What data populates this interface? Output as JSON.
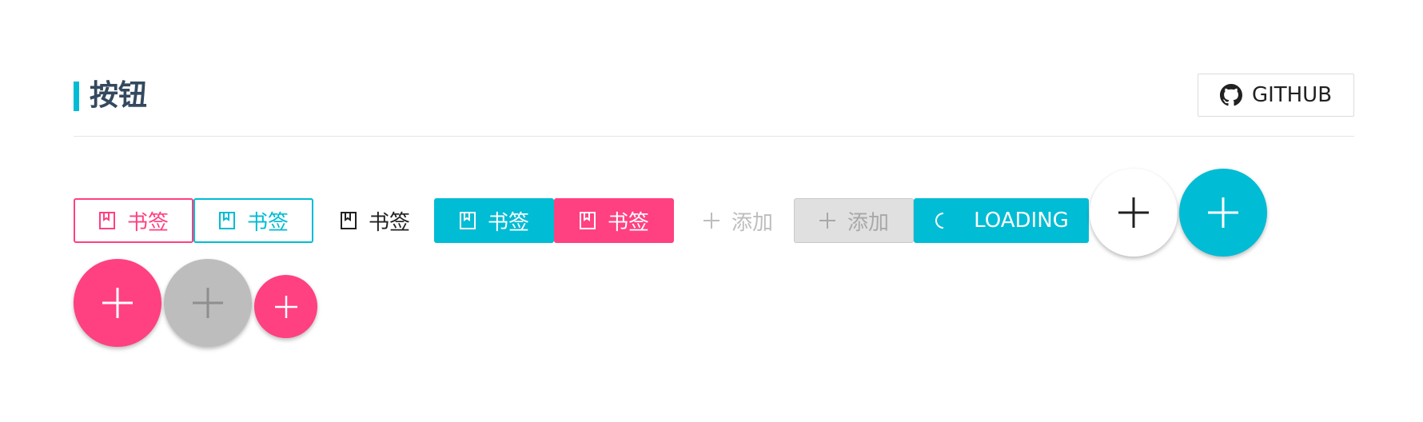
{
  "header": {
    "title": "按钮",
    "github_label": "GITHUB"
  },
  "buttons": {
    "outline_pink": {
      "label": "书签",
      "icon": "bookmark-icon"
    },
    "outline_cyan": {
      "label": "书签",
      "icon": "bookmark-icon"
    },
    "flat": {
      "label": "书签",
      "icon": "bookmark-icon"
    },
    "solid_cyan": {
      "label": "书签",
      "icon": "bookmark-icon"
    },
    "solid_pink": {
      "label": "书签",
      "icon": "bookmark-icon"
    },
    "flat_disabled": {
      "label": "添加",
      "icon": "plus-icon"
    },
    "raised_disabled": {
      "label": "添加",
      "icon": "plus-icon"
    },
    "loading": {
      "label": "LOADING",
      "icon": "spinner-icon"
    }
  },
  "fabs": [
    {
      "name": "fab-white",
      "icon": "plus-icon"
    },
    {
      "name": "fab-cyan",
      "icon": "plus-icon"
    },
    {
      "name": "fab-pink",
      "icon": "plus-icon"
    },
    {
      "name": "fab-disabled",
      "icon": "plus-icon"
    },
    {
      "name": "fab-mini-pink",
      "icon": "plus-icon"
    }
  ],
  "colors": {
    "primary": "#00bcd4",
    "accent": "#ff4081",
    "title": "#34495e",
    "disabled": "#bdbdbd"
  }
}
